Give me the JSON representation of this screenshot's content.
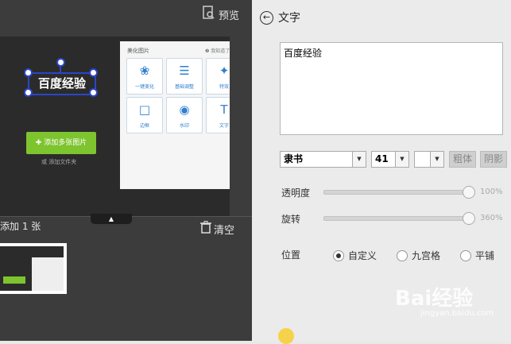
{
  "left": {
    "preview_label": "预览",
    "canvas_overlay_text": "百度经验",
    "add_button_label": "✚ 添加多张图片",
    "add_folder_label": "或 添加文件夹",
    "panel": {
      "heading": "美化图片",
      "tip": "❷ 我知道了",
      "tiles": [
        {
          "label": "一键美化",
          "icon": "tulip-icon"
        },
        {
          "label": "基础调整",
          "icon": "sliders-icon"
        },
        {
          "label": "特效",
          "icon": "magic-wand-icon"
        },
        {
          "label": "边框",
          "icon": "square-frame-icon"
        },
        {
          "label": "水印",
          "icon": "watermark-icon"
        },
        {
          "label": "文字",
          "icon": "text-icon"
        }
      ]
    },
    "add_count": "添加 1 张",
    "clear_label": "清空"
  },
  "right": {
    "title": "文字",
    "text_value": "百度经验",
    "font": "隶书",
    "size": "41",
    "color": "",
    "bold_label": "粗体",
    "shadow_label": "阴影",
    "opacity_label": "透明度",
    "opacity_value": "100%",
    "opacity_fraction": 1.0,
    "rotate_label": "旋转",
    "rotate_value": "360%",
    "rotate_fraction": 1.0,
    "position_label": "位置",
    "position_options": [
      "自定义",
      "九宫格",
      "平铺"
    ],
    "position_selected": "自定义"
  },
  "watermark": {
    "brand": "Bai经验",
    "url": "jingyan.baidu.com"
  }
}
